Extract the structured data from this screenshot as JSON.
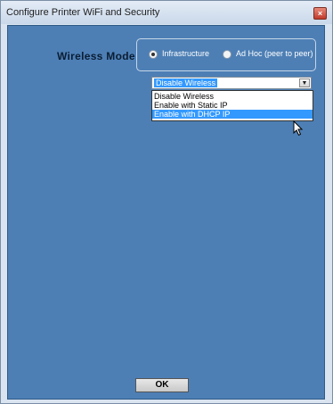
{
  "window": {
    "title": "Configure Printer WiFi and Security",
    "close_glyph": "×"
  },
  "wireless_mode": {
    "label": "Wireless Mode",
    "options": [
      {
        "label": "Infrastructure",
        "selected": true
      },
      {
        "label": "Ad Hoc (peer to peer)",
        "selected": false
      }
    ]
  },
  "wireless_select": {
    "value": "Disable Wireless",
    "arrow_glyph": "▼",
    "options": [
      "Disable Wireless",
      "Enable with Static IP",
      "Enable with DHCP IP"
    ],
    "highlighted_index": 2
  },
  "ok_label": "OK",
  "colors": {
    "panel": "#4d7fb5",
    "highlight": "#3399ff"
  }
}
